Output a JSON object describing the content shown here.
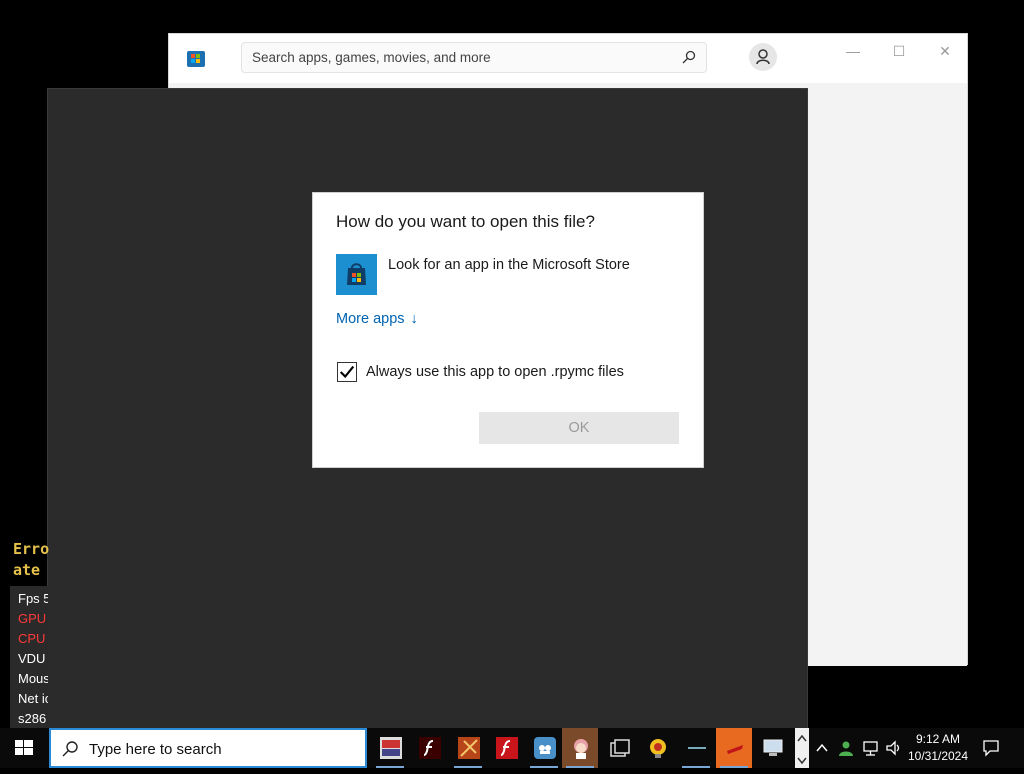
{
  "store": {
    "search_placeholder": "Search apps, games, movies, and more",
    "controls": [
      "—",
      "☐",
      "✕"
    ]
  },
  "overlay_left": {
    "error_lines": [
      "Erro",
      "ate"
    ],
    "stats": [
      "Fps 5",
      "GPU",
      "CPU",
      "VDU",
      "Mous",
      "Net ic",
      "s286"
    ]
  },
  "dialog": {
    "title": "How do you want to open this file?",
    "store_option": "Look for an app in the Microsoft Store",
    "more_apps": "More apps",
    "more_apps_arrow": "↓",
    "always_use": "Always use this app to open .rpymc files",
    "always_use_checked": true,
    "ok": "OK"
  },
  "taskbar": {
    "search_placeholder": "Type here to search",
    "time": "9:12 AM",
    "date": "10/31/2024",
    "apps": [
      "photo-viewer-icon",
      "flash-icon",
      "game-icon",
      "flash-icon",
      "cloud-app-icon",
      "anime-character-icon",
      "task-view-icon",
      "gold-app-icon",
      "text-app-icon",
      "red-app-icon",
      "computer-icon"
    ]
  },
  "colors": {
    "accent": "#0063b1",
    "taskbar_search_border": "#2b8ad6",
    "store_tile": "#1c8fd1",
    "error_yellow": "#e6c24a",
    "stat_red": "#ff3a3a"
  }
}
